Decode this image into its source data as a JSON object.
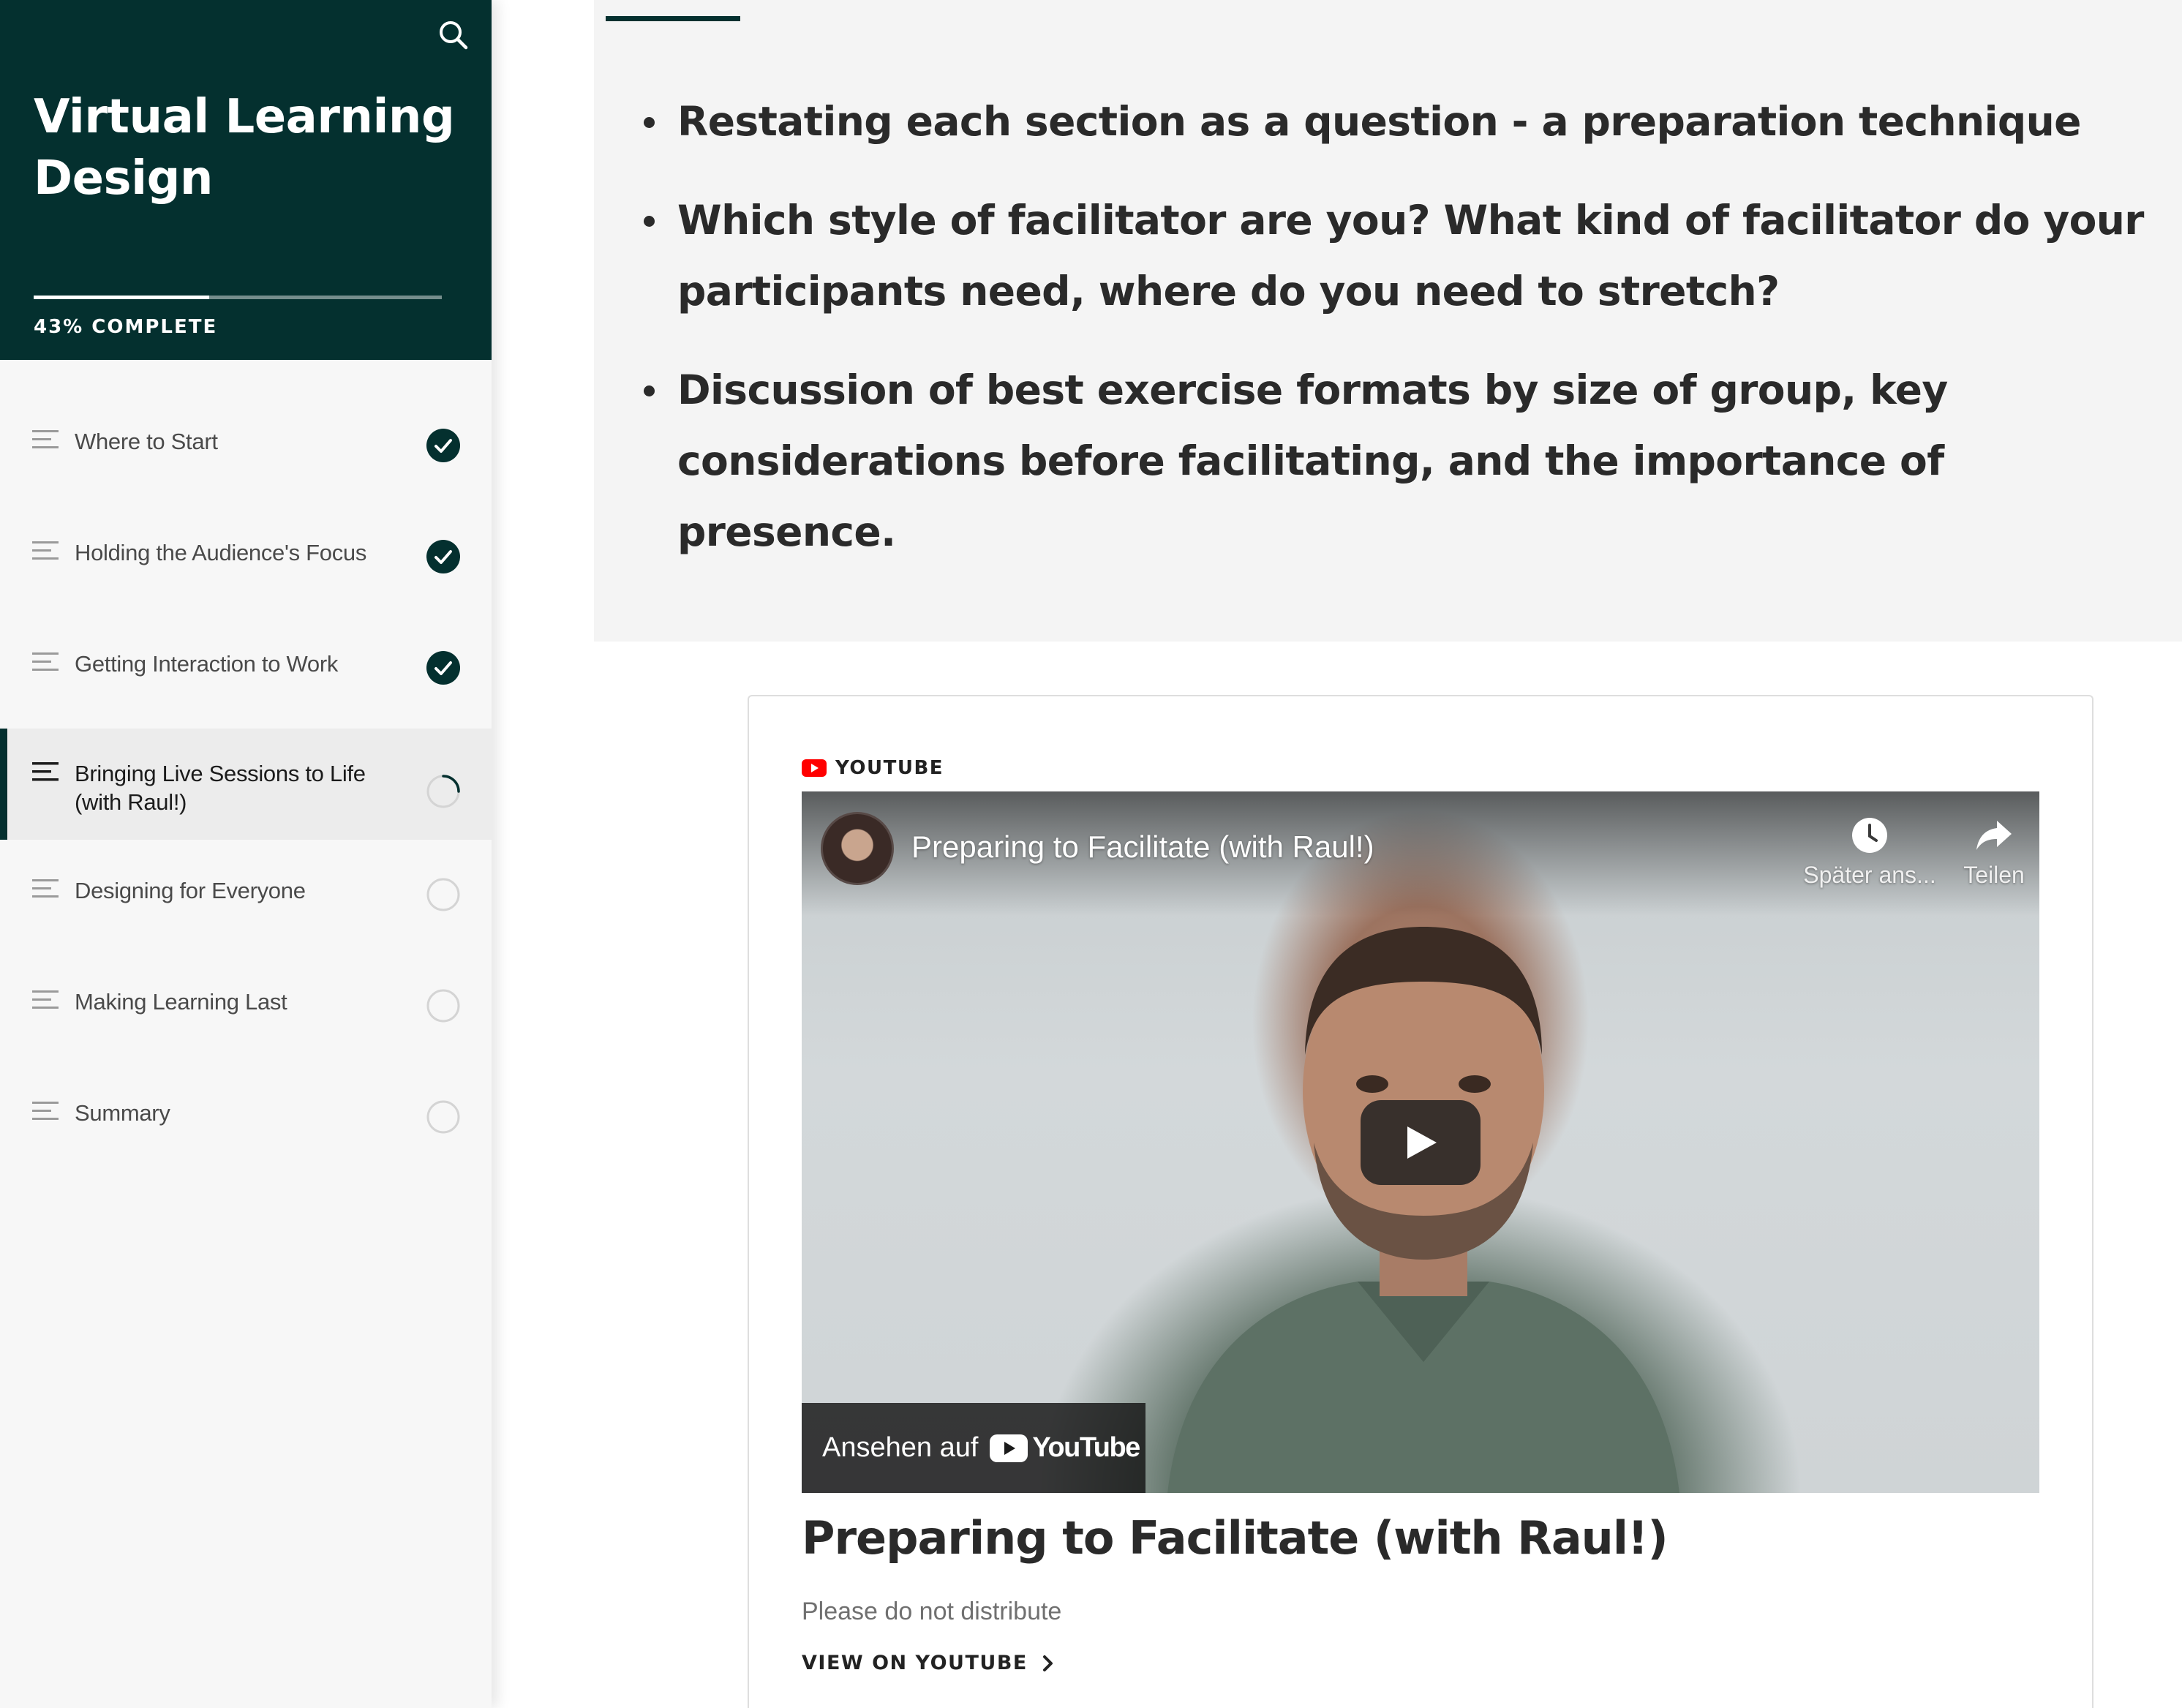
{
  "sidebar": {
    "course_title": "Virtual Learning Design",
    "progress": {
      "label": "43% COMPLETE",
      "percent": 43
    },
    "lessons": [
      {
        "label": "Where to Start",
        "status": "complete"
      },
      {
        "label": "Holding the Audience's Focus",
        "status": "complete"
      },
      {
        "label": "Getting Interaction to Work",
        "status": "complete"
      },
      {
        "label": "Bringing Live Sessions to Life (with Raul!)",
        "status": "in-progress",
        "active": true
      },
      {
        "label": "Designing for Everyone",
        "status": "not-started"
      },
      {
        "label": "Making Learning Last",
        "status": "not-started"
      },
      {
        "label": "Summary",
        "status": "not-started"
      }
    ]
  },
  "content": {
    "bullets": [
      "Restating each section as a question - a preparation technique",
      "Which style of facilitator are you? What kind of facilitator do your participants need, where do you need to stretch?",
      "Discussion of best exercise formats by size of group, key considerations before facilitating, and the importance of presence."
    ]
  },
  "embed": {
    "provider_label": "YOUTUBE",
    "video": {
      "title": "Preparing to Facilitate (with Raul!)",
      "watch_later_label": "Später ans...",
      "share_label": "Teilen",
      "watch_on_label": "Ansehen auf",
      "youtube_logo_text": "YouTube"
    },
    "title": "Preparing to Facilitate (with Raul!)",
    "description": "Please do not distribute",
    "view_link_label": "VIEW ON YOUTUBE"
  },
  "colors": {
    "brand_dark": "#04302f",
    "youtube_red": "#ff0000",
    "panel_bg": "#f4f4f4",
    "sidebar_bg": "#f7f7f7"
  },
  "icons": {
    "search": "search-icon",
    "lesson": "lines-icon",
    "complete": "check-circle-icon",
    "in_progress": "progress-ring-icon",
    "not_started": "empty-circle-icon",
    "watch_later": "clock-icon",
    "share": "share-arrow-icon",
    "play": "play-icon",
    "chevron": "chevron-right-icon"
  }
}
